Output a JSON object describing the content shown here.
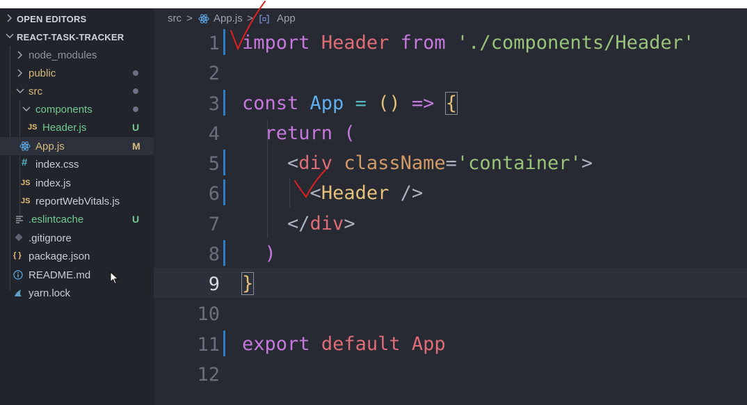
{
  "sidebar": {
    "open_editors": "OPEN EDITORS",
    "project": "REACT-TASK-TRACKER",
    "items": [
      {
        "label": "node_modules",
        "badge": ""
      },
      {
        "label": "public",
        "badge": ""
      },
      {
        "label": "src",
        "badge": ""
      },
      {
        "label": "components",
        "badge": ""
      },
      {
        "label": "Header.js",
        "badge": "U",
        "icon": "JS"
      },
      {
        "label": "App.js",
        "badge": "M"
      },
      {
        "label": "index.css",
        "badge": "",
        "icon": "#"
      },
      {
        "label": "index.js",
        "badge": "",
        "icon": "JS"
      },
      {
        "label": "reportWebVitals.js",
        "badge": "",
        "icon": "JS"
      },
      {
        "label": ".eslintcache",
        "badge": "U"
      },
      {
        "label": ".gitignore",
        "badge": ""
      },
      {
        "label": "package.json",
        "badge": "",
        "icon": "{ }"
      },
      {
        "label": "README.md",
        "badge": ""
      },
      {
        "label": "yarn.lock",
        "badge": ""
      }
    ]
  },
  "breadcrumb": {
    "folder": "src",
    "file": "App.js",
    "symbol": "App",
    "sep": ">"
  },
  "line_numbers": [
    "1",
    "2",
    "3",
    "4",
    "5",
    "6",
    "7",
    "8",
    "9",
    "10",
    "11",
    "12"
  ],
  "code": {
    "l1": {
      "kw": "import",
      "id": "Header",
      "from": "from",
      "str": "'./components/Header'"
    },
    "l3": {
      "kw": "const",
      "name": "App",
      "eq": "=",
      "parens": "()",
      "arrow": "=>",
      "brace": "{"
    },
    "l4": {
      "kw": "return",
      "paren": "("
    },
    "l5": {
      "open": "<",
      "tag": "div",
      "attr": "className",
      "eq": "=",
      "val": "'container'",
      "close": ">"
    },
    "l6": {
      "open": "<",
      "tag": "Header",
      "close": " />"
    },
    "l7": {
      "open": "</",
      "tag": "div",
      "close": ">"
    },
    "l8": {
      "paren": ")"
    },
    "l9": {
      "brace": "}"
    },
    "l11": {
      "kw": "export",
      "kw2": "default",
      "name": "App"
    }
  },
  "colors": {
    "sidebar_bg": "#21242b",
    "editor_bg": "#272a33",
    "modified": "#d7ba7d",
    "untracked": "#73c991",
    "gutter_mark": "#2b7fc9",
    "annotation": "#e02020"
  }
}
